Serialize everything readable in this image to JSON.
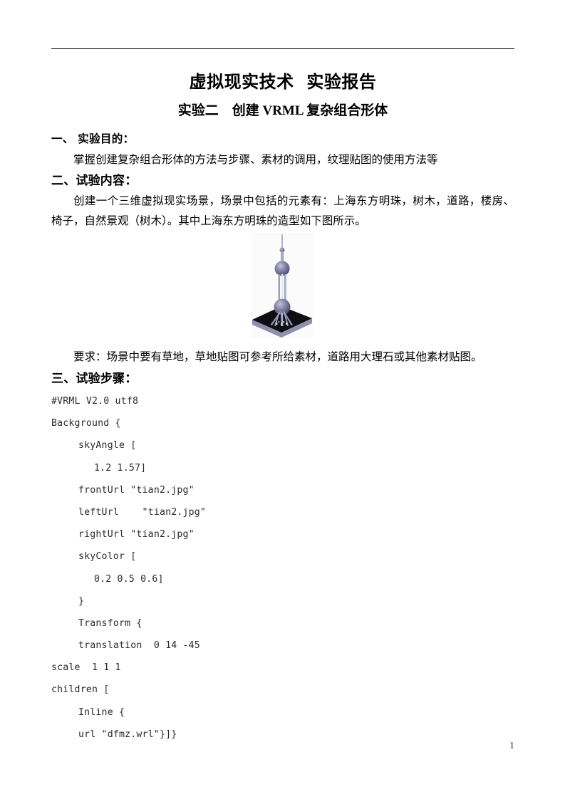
{
  "document": {
    "title": "虚拟现实技术  实验报告",
    "subtitle": "实验二　创建 VRML 复杂组合形体",
    "page_number": "1"
  },
  "sections": [
    {
      "heading": "一、 实验目的：",
      "paragraph": "掌握创建复杂组合形体的方法与步骤、素材的调用，纹理贴图的使用方法等"
    },
    {
      "heading": "二、试验内容：",
      "paragraph": "创建一个三维虚拟现实场景，场景中包括的元素有：上海东方明珠，树木，道路，楼房、椅子，自然景观（树木）。其中上海东方明珠的造型如下图所示。",
      "requirement": "要求：场景中要有草地，草地贴图可参考所给素材，道路用大理石或其他素材贴图。"
    },
    {
      "heading": "三、试验步骤："
    }
  ],
  "figure": {
    "caption": "",
    "alt": "上海东方明珠三维模型",
    "colors": {
      "sphere": "#6b6b8e",
      "sphere_light": "#b6b6cf",
      "mast": "#9a9ab8",
      "platform_top": "#0d0d12",
      "platform_side": "#8f8fae",
      "background": "#fbfbfc"
    }
  },
  "code": {
    "language": "VRML",
    "lines": [
      {
        "indent": 0,
        "text": "#VRML V2.0 utf8"
      },
      {
        "indent": 0,
        "text": "Background {"
      },
      {
        "indent": 1,
        "text": "skyAngle ["
      },
      {
        "indent": 2,
        "text": "1.2 1.57]"
      },
      {
        "indent": 1,
        "text": "frontUrl \"tian2.jpg\""
      },
      {
        "indent": 1,
        "text": "leftUrl    \"tian2.jpg\""
      },
      {
        "indent": 1,
        "text": "rightUrl \"tian2.jpg\""
      },
      {
        "indent": 1,
        "text": "skyColor ["
      },
      {
        "indent": 2,
        "text": "0.2 0.5 0.6]"
      },
      {
        "indent": 1,
        "text": "}"
      },
      {
        "indent": 1,
        "text": "Transform {"
      },
      {
        "indent": 1,
        "text": "translation  0 14 -45"
      },
      {
        "indent": 0,
        "text": "scale  1 1 1"
      },
      {
        "indent": 0,
        "text": "children ["
      },
      {
        "indent": 1,
        "text": "Inline {"
      },
      {
        "indent": 1,
        "text": "url \"dfmz.wrl\"}]}"
      }
    ]
  }
}
